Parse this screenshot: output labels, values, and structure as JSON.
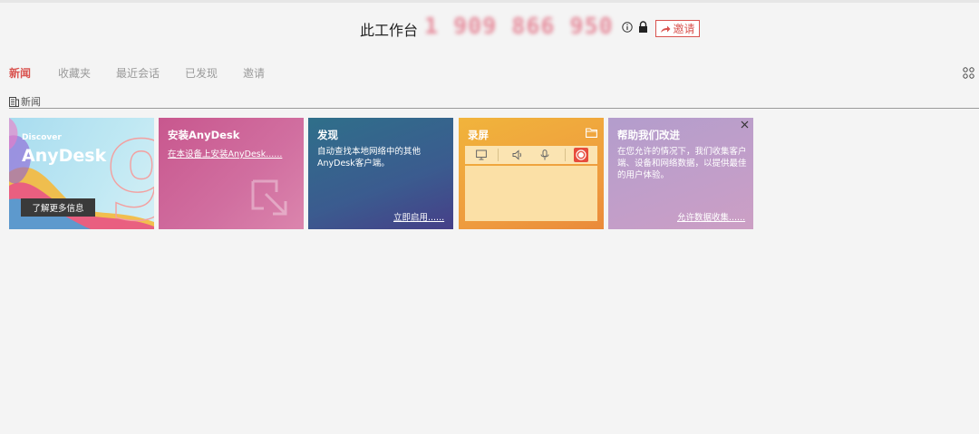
{
  "header": {
    "workstation_label": "此工作台",
    "workstation_id": "1 909 866 950",
    "invite_label": "邀请"
  },
  "tabs": [
    {
      "label": "新闻",
      "active": true
    },
    {
      "label": "收藏夹",
      "active": false
    },
    {
      "label": "最近会话",
      "active": false
    },
    {
      "label": "已发现",
      "active": false
    },
    {
      "label": "邀请",
      "active": false
    }
  ],
  "section": {
    "label": "新闻"
  },
  "cards": {
    "discover": {
      "small": "Discover",
      "big": "AnyDesk",
      "button": "了解更多信息",
      "version_digit": "9"
    },
    "install": {
      "title": "安装AnyDesk",
      "link": "在本设备上安装AnyDesk......"
    },
    "discovery": {
      "title": "发现",
      "text": "自动查找本地网络中的其他AnyDesk客户端。",
      "link": "立即启用......"
    },
    "recording": {
      "title": "录屏"
    },
    "help": {
      "title": "帮助我们改进",
      "text": "在您允许的情况下，我们收集客户端、设备和网络数据，以提供最佳的用户体验。",
      "link": "允许数据收集......"
    }
  },
  "colors": {
    "accent": "#d9534f",
    "card_discover": "#bfe8f3",
    "card_install": "#d16fa0",
    "card_discovery": "#3b5b8f",
    "card_recording": "#ee9a3e",
    "card_help": "#c29ec9"
  }
}
